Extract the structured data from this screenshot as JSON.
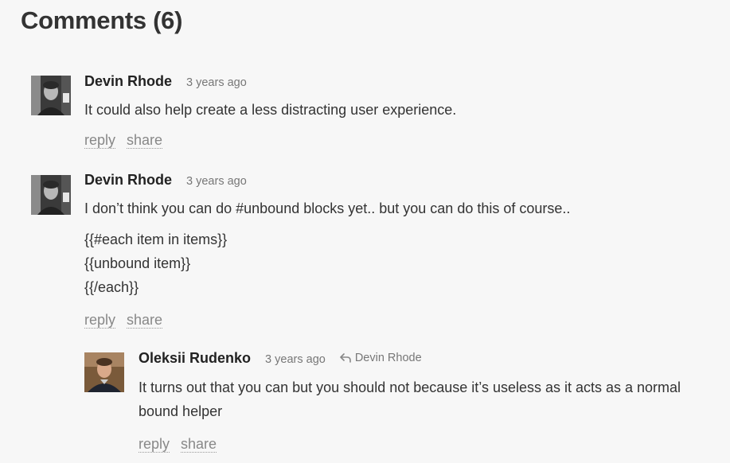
{
  "header": {
    "title": "Comments (6)"
  },
  "comments": [
    {
      "author": "Devin Rhode",
      "time": "3 years ago",
      "text": "It could also help create a less distracting user experience.",
      "actions": {
        "reply": "reply",
        "share": "share"
      }
    },
    {
      "author": "Devin Rhode",
      "time": "3 years ago",
      "text": "I don’t think you can do #unbound blocks yet.. but you can do this of course..",
      "code_lines": [
        "{{#each item in items}}",
        "{{unbound item}}",
        "{{/each}}"
      ],
      "actions": {
        "reply": "reply",
        "share": "share"
      }
    },
    {
      "author": "Oleksii Rudenko",
      "time": "3 years ago",
      "reply_to": "Devin Rhode",
      "text_lines": [
        "It turns out that you can but you should not because it’s useless as it acts as a normal",
        "bound helper"
      ],
      "actions": {
        "reply": "reply",
        "share": "share"
      }
    }
  ]
}
